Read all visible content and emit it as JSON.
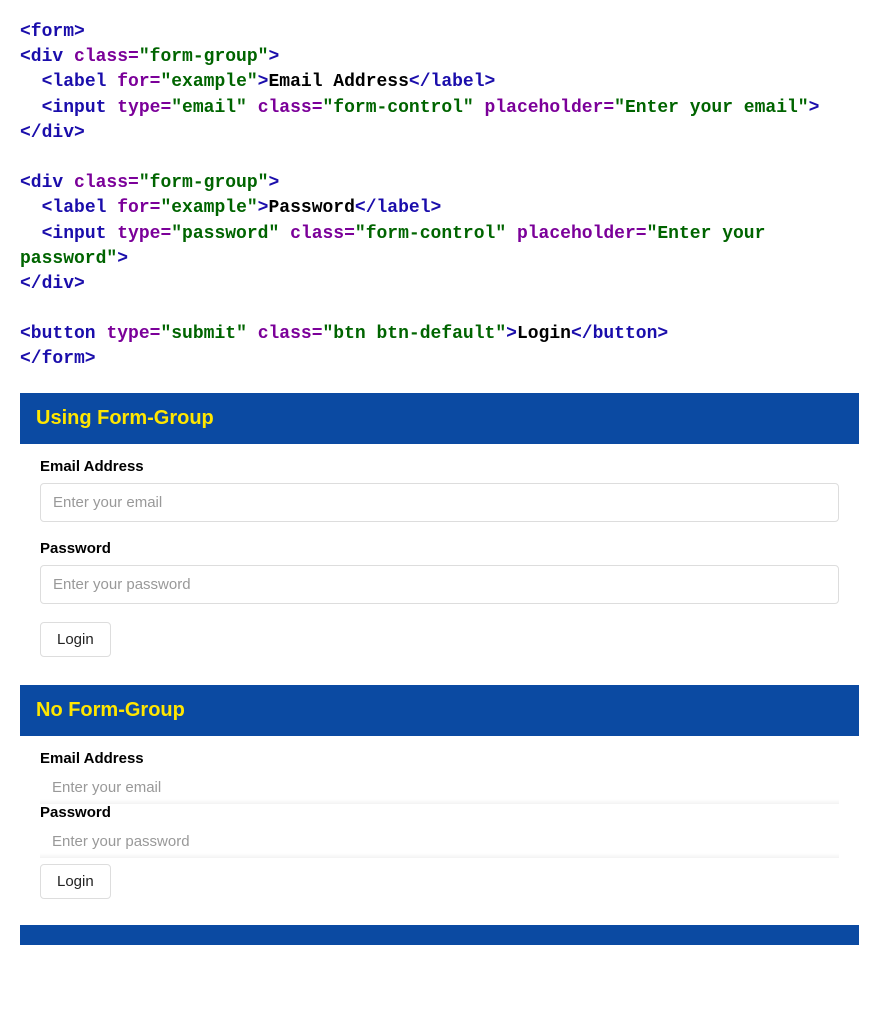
{
  "code": {
    "lines": [
      [
        [
          "tag",
          "<form>"
        ]
      ],
      [
        [
          "tag",
          "<div"
        ],
        [
          "text",
          " "
        ],
        [
          "attr",
          "class="
        ],
        [
          "str",
          "\"form-group\""
        ],
        [
          "tag",
          ">"
        ]
      ],
      [
        [
          "text",
          "  "
        ],
        [
          "tag",
          "<label"
        ],
        [
          "text",
          " "
        ],
        [
          "attr",
          "for="
        ],
        [
          "str",
          "\"example\""
        ],
        [
          "tag",
          ">"
        ],
        [
          "text",
          "Email Address"
        ],
        [
          "tag",
          "</label>"
        ]
      ],
      [
        [
          "text",
          "  "
        ],
        [
          "tag",
          "<input"
        ],
        [
          "text",
          " "
        ],
        [
          "attr",
          "type="
        ],
        [
          "str",
          "\"email\""
        ],
        [
          "text",
          " "
        ],
        [
          "attr",
          "class="
        ],
        [
          "str",
          "\"form-control\""
        ],
        [
          "text",
          " "
        ],
        [
          "attr",
          "placeholder="
        ],
        [
          "str",
          "\"Enter your email\""
        ],
        [
          "tag",
          ">"
        ]
      ],
      [
        [
          "tag",
          "</div>"
        ]
      ],
      [
        [
          "text",
          ""
        ]
      ],
      [
        [
          "tag",
          "<div"
        ],
        [
          "text",
          " "
        ],
        [
          "attr",
          "class="
        ],
        [
          "str",
          "\"form-group\""
        ],
        [
          "tag",
          ">"
        ]
      ],
      [
        [
          "text",
          "  "
        ],
        [
          "tag",
          "<label"
        ],
        [
          "text",
          " "
        ],
        [
          "attr",
          "for="
        ],
        [
          "str",
          "\"example\""
        ],
        [
          "tag",
          ">"
        ],
        [
          "text",
          "Password"
        ],
        [
          "tag",
          "</label>"
        ]
      ],
      [
        [
          "text",
          "  "
        ],
        [
          "tag",
          "<input"
        ],
        [
          "text",
          " "
        ],
        [
          "attr",
          "type="
        ],
        [
          "str",
          "\"password\""
        ],
        [
          "text",
          " "
        ],
        [
          "attr",
          "class="
        ],
        [
          "str",
          "\"form-control\""
        ],
        [
          "text",
          " "
        ],
        [
          "attr",
          "placeholder="
        ],
        [
          "str",
          "\"Enter your password\""
        ],
        [
          "tag",
          ">"
        ]
      ],
      [
        [
          "tag",
          "</div>"
        ]
      ],
      [
        [
          "text",
          ""
        ]
      ],
      [
        [
          "tag",
          "<button"
        ],
        [
          "text",
          " "
        ],
        [
          "attr",
          "type="
        ],
        [
          "str",
          "\"submit\""
        ],
        [
          "text",
          " "
        ],
        [
          "attr",
          "class="
        ],
        [
          "str",
          "\"btn btn-default\""
        ],
        [
          "tag",
          ">"
        ],
        [
          "text",
          "Login"
        ],
        [
          "tag",
          "</button>"
        ]
      ],
      [
        [
          "tag",
          "</form>"
        ]
      ]
    ]
  },
  "section1": {
    "title": "Using Form-Group",
    "email_label": "Email Address",
    "email_placeholder": "Enter your email",
    "password_label": "Password",
    "password_placeholder": "Enter your password",
    "login_label": "Login"
  },
  "section2": {
    "title": "No Form-Group",
    "email_label": "Email Address",
    "email_placeholder": "Enter your email",
    "password_label": "Password",
    "password_placeholder": "Enter your password",
    "login_label": "Login"
  }
}
